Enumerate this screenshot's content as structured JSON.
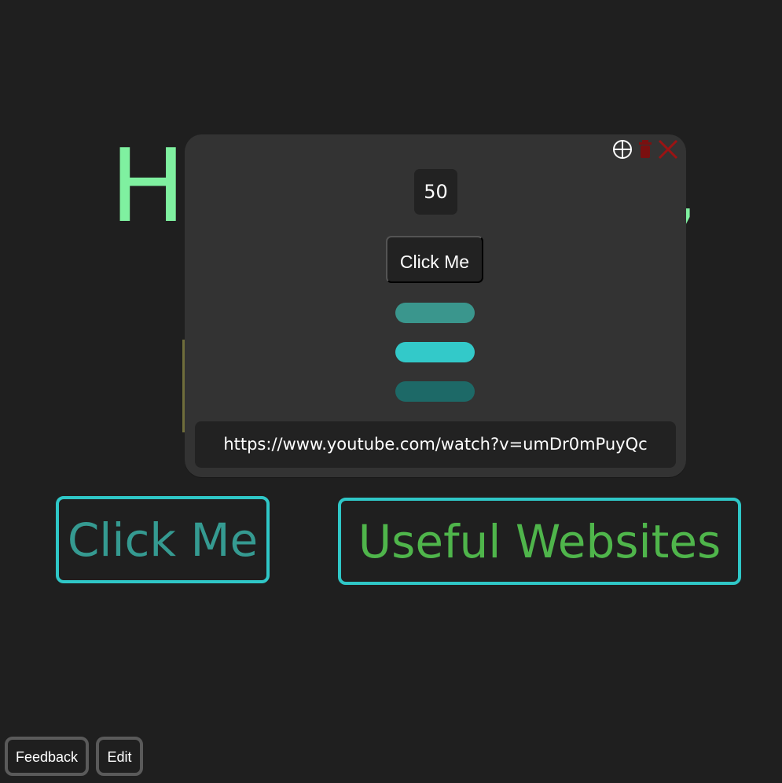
{
  "page": {
    "headline": "H",
    "headline_right_glyph": ","
  },
  "popup": {
    "counter_value": "50",
    "button_label": "Click Me",
    "url": "https://www.youtube.com/watch?v=umDr0mPuyQc",
    "tools": [
      {
        "icon": "plus-circle-icon",
        "color": "#ffffff"
      },
      {
        "icon": "trash-icon",
        "color": "#7a1010"
      },
      {
        "icon": "close-icon",
        "color": "#9b1313"
      }
    ],
    "pills": [
      {
        "color": "#3a968d"
      },
      {
        "color": "#33c9c9"
      },
      {
        "color": "#1d6967"
      }
    ]
  },
  "main": {
    "click_button": "Click Me",
    "websites_button": "Useful Websites"
  },
  "footer": {
    "feedback_label": "Feedback",
    "edit_label": "Edit"
  },
  "colors": {
    "background": "#1f1f1f",
    "headline": "#7ff0a0",
    "popup": "#333333",
    "button_border": "#2fc7c7",
    "click_text": "#359a91",
    "websites_text": "#4fb54b"
  }
}
